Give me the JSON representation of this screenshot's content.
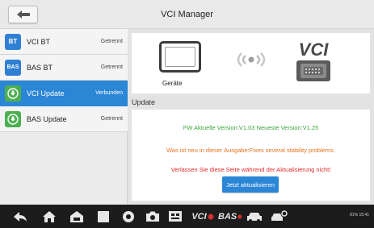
{
  "header": {
    "title": "VCI Manager",
    "back_icon": "arrow-left-icon"
  },
  "sidebar": {
    "items": [
      {
        "badge": "BT",
        "label": "VCI BT",
        "status": "Getrennt",
        "badge_color": "#2f7fd3",
        "active": false
      },
      {
        "badge": "BAS",
        "label": "BAS BT",
        "status": "Getrennt",
        "badge_color": "#2f7fd3",
        "active": false
      },
      {
        "badge_icon": "download-icon",
        "label": "VCI Update",
        "status": "Verbunden",
        "badge_color": "#4caf50",
        "active": true
      },
      {
        "badge_icon": "download-icon",
        "label": "BAS Update",
        "status": "Getrennt",
        "badge_color": "#4caf50",
        "active": false
      }
    ]
  },
  "device": {
    "label": "Geräte",
    "logo_text": "VCI"
  },
  "update": {
    "heading": "Update",
    "version_text": "FW Aktuelle Version:V1.03 Neueste Version:V1.25",
    "whats_new": "Was ist neu in dieser Ausgabe:Fixes several stability problems.",
    "warning": "Verlassen Sie diese Seite während der Aktualisierung nicht!",
    "button_label": "Jetzt aktualisieren"
  },
  "navbar": {
    "vci_label": "VCI",
    "bas_label": "BAS",
    "status_text": "81%  15:41"
  },
  "colors": {
    "accent": "#2b86d6",
    "green": "#3aa33a",
    "orange": "#e8731c",
    "red": "#e02a2a"
  }
}
